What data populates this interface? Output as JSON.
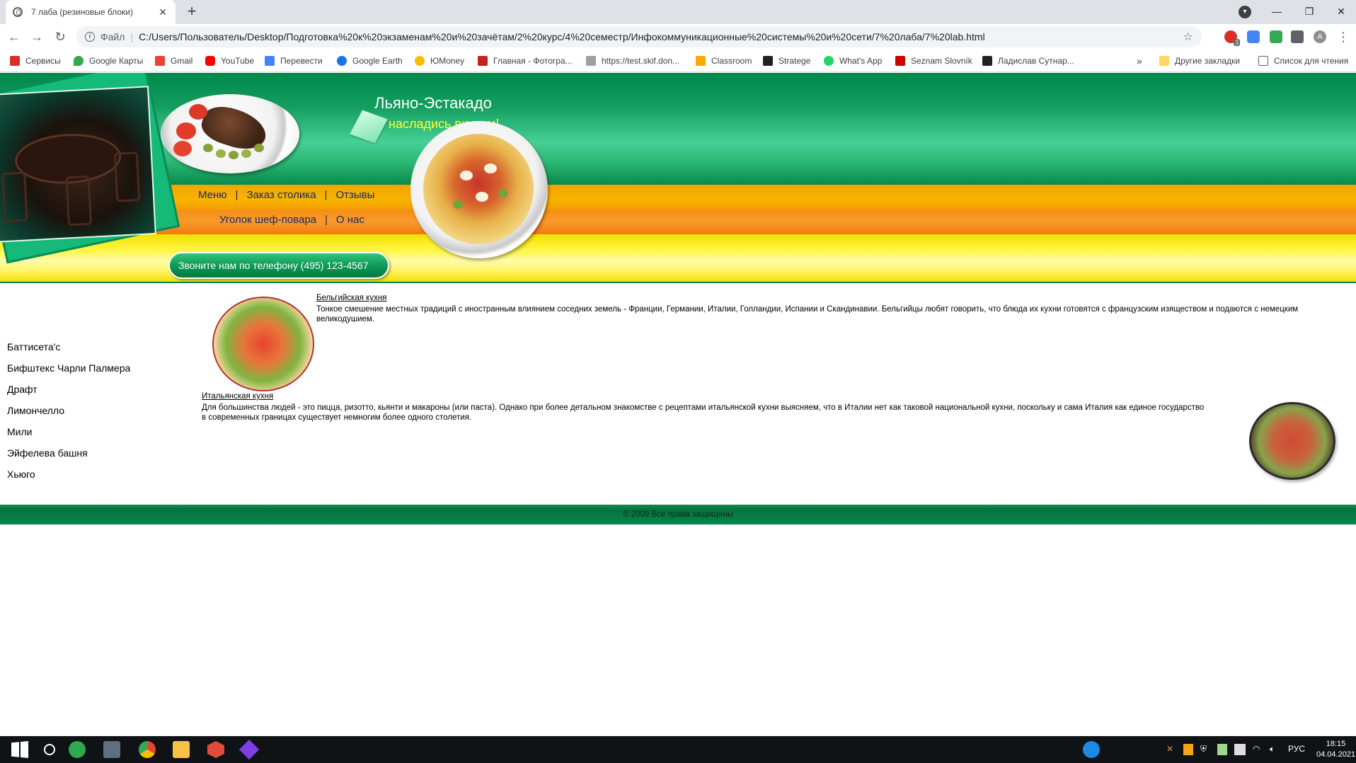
{
  "tab": {
    "title": "7 лаба (резиновые блоки)"
  },
  "omnibox": {
    "scheme_label": "Файл",
    "url": "C:/Users/Пользователь/Desktop/Подготовка%20к%20экзаменам%20и%20зачётам/2%20курс/4%20семестр/Инфокоммуникационные%20системы%20и%20сети/7%20лаба/7%20lab.html"
  },
  "extension_badge": "3",
  "profile_initial": "A",
  "bookmarks": {
    "items": [
      {
        "label": "Сервисы",
        "icon": "apps-grid-icon",
        "color": "#d93025"
      },
      {
        "label": "Google Карты",
        "icon": "maps-pin-icon",
        "color": "#34a853"
      },
      {
        "label": "Gmail",
        "icon": "gmail-icon",
        "color": "#ea4335"
      },
      {
        "label": "YouTube",
        "icon": "youtube-icon",
        "color": "#ff0000"
      },
      {
        "label": "Перевести",
        "icon": "translate-icon",
        "color": "#4285f4"
      },
      {
        "label": "Google Earth",
        "icon": "earth-icon",
        "color": "#1a73e8"
      },
      {
        "label": "ЮMoney",
        "icon": "money-icon",
        "color": "#fbbc04"
      },
      {
        "label": "Главная - Фотогра...",
        "icon": "photo-icon",
        "color": "#c5221f"
      },
      {
        "label": "https://test.skif.don...",
        "icon": "page-icon",
        "color": "#9aa0a6"
      },
      {
        "label": "Classroom",
        "icon": "classroom-icon",
        "color": "#f9ab00"
      },
      {
        "label": "Stratege",
        "icon": "stratege-icon",
        "color": "#202124"
      },
      {
        "label": "What's App",
        "icon": "whatsapp-icon",
        "color": "#25d366"
      },
      {
        "label": "Seznam Slovník",
        "icon": "seznam-icon",
        "color": "#cc0000"
      },
      {
        "label": "Ладислав Сутнар...",
        "icon": "bookmark-icon",
        "color": "#202124"
      }
    ],
    "overflow": "»",
    "other_folder": "Другие закладки",
    "reading_list": "Список для чтения"
  },
  "site": {
    "title": "Льяно-Эстакадо",
    "tagline": "насладись вкусом!",
    "nav_row1": [
      "Меню",
      "Заказ столика",
      "Отзывы"
    ],
    "nav_row2": [
      "Уголок шеф-повара",
      "О нас"
    ],
    "nav_separator": "|",
    "phone": "Звоните нам по телефону (495) 123-4567"
  },
  "sidebar": [
    "Баттисета'с",
    "Бифштекс Чарли Палмера",
    "Драфт",
    "Лимончелло",
    "Мили",
    "Эйфелева башня",
    "Хьюго"
  ],
  "sections": [
    {
      "title": "Бельгийская кухня",
      "text": "Тонкое смешение местных традиций с иностранным влиянием соседних земель - Франции, Германии, Италии, Голландии, Испании и Скандинавии. Бельгийцы любят говорить, что блюда их кухни готовятся с французским изяществом и подаются с немецким великодушием."
    },
    {
      "title": "Итальянская кухня",
      "text": "Для большинства людей - это пицца, ризотто, кьянти и макароны (или паста). Однако при более детальном знакомстве с рецептами итальянской кухни выясняем, что в Италии нет как таковой национальной кухни, поскольку и сама Италия как единое государство в современных границах существует немногим более одного столетия."
    }
  ],
  "footer": "© 2009 Все права защищены",
  "tray": {
    "language": "РУС",
    "time": "18:15",
    "date": "04.04.2021"
  },
  "colors": {
    "green": "#00874c",
    "orange": "#f58f1a",
    "yellow": "#fff74a",
    "nav_text": "#1a2a6b",
    "tagline": "#ffff33"
  }
}
